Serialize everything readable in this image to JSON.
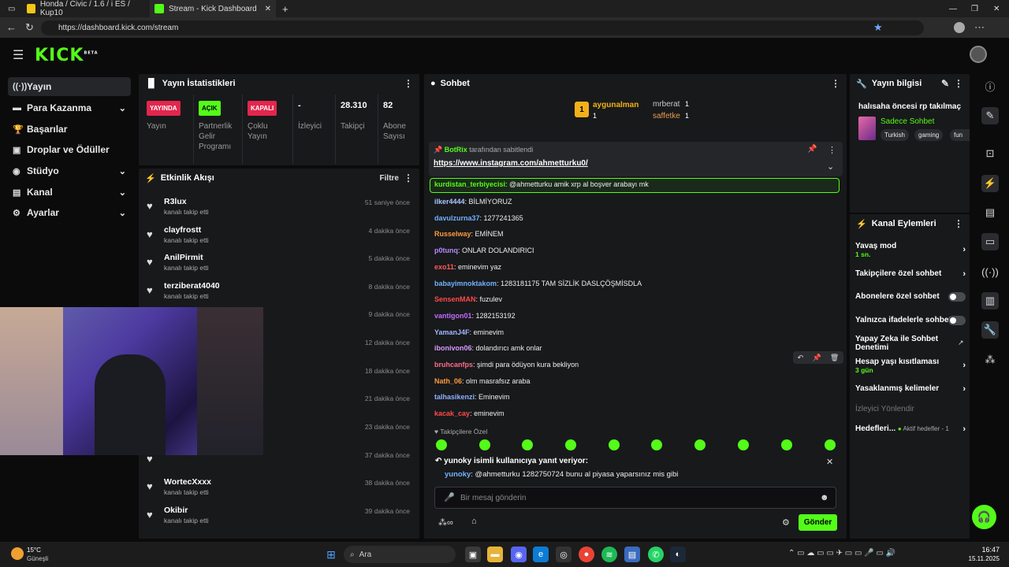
{
  "browser": {
    "tabs": [
      {
        "label": "Honda / Civic / 1.6 / i ES / Kup10"
      },
      {
        "label": "Stream - Kick Dashboard"
      }
    ],
    "url": "https://dashboard.kick.com/stream"
  },
  "brand": {
    "logo": "KICK",
    "beta": "BETA",
    "accent": "#53fc18"
  },
  "sidebar": {
    "items": [
      {
        "label": "Yayın",
        "icon": "broadcast-icon"
      },
      {
        "label": "Para Kazanma",
        "icon": "money-icon"
      },
      {
        "label": "Başarılar",
        "icon": "trophy-icon"
      },
      {
        "label": "Droplar ve Ödüller",
        "icon": "gift-icon"
      },
      {
        "label": "Stüdyo",
        "icon": "studio-icon"
      },
      {
        "label": "Kanal",
        "icon": "channel-icon"
      },
      {
        "label": "Ayarlar",
        "icon": "gear-icon"
      }
    ]
  },
  "stats": {
    "title": "Yayın İstatistikleri",
    "columns": [
      {
        "value": "YAYINDA",
        "label": "Yayın"
      },
      {
        "value": "AÇIK",
        "label": "Partnerlik Gelir Programı"
      },
      {
        "value": "KAPALI",
        "label": "Çoklu Yayın"
      },
      {
        "value": "-",
        "label": "İzleyici"
      },
      {
        "value": "28.310",
        "label": "Takipçi"
      },
      {
        "value": "82",
        "label": "Abone Sayısı"
      }
    ]
  },
  "activity": {
    "title": "Etkinlik Akışı",
    "filter": "Filtre",
    "items": [
      {
        "name": "R3lux",
        "sub": "kanalı takip etti",
        "time": "51 saniye önce"
      },
      {
        "name": "clayfrostt",
        "sub": "kanalı takip etti",
        "time": "4 dakika önce"
      },
      {
        "name": "AnilPirmit",
        "sub": "kanalı takip etti",
        "time": "5 dakika önce"
      },
      {
        "name": "terziberat4040",
        "sub": "kanalı takip etti",
        "time": "8 dakika önce"
      },
      {
        "name": "",
        "sub": "",
        "time": "9 dakika önce"
      },
      {
        "name": "",
        "sub": "",
        "time": "12 dakika önce"
      },
      {
        "name": "",
        "sub": "",
        "time": "18 dakika önce"
      },
      {
        "name": "",
        "sub": "",
        "time": "21 dakika önce"
      },
      {
        "name": "",
        "sub": "",
        "time": "23 dakika önce"
      },
      {
        "name": "",
        "sub": "",
        "time": "37 dakika önce"
      },
      {
        "name": "WortecXxxx",
        "sub": "kanalı takip etti",
        "time": "38 dakika önce"
      },
      {
        "name": "Okibir",
        "sub": "kanalı takip etti",
        "time": "39 dakika önce"
      }
    ]
  },
  "chat": {
    "title": "Sohbet",
    "leaders": [
      {
        "rank": "1",
        "name": "aygunalman",
        "count": "1"
      },
      {
        "name": "mrberat",
        "count": "1"
      },
      {
        "name": "saffetke",
        "count": "1"
      }
    ],
    "pinned": {
      "by": "BotRix",
      "suffix": "tarafından sabitlendi",
      "link": "https://www.instagram.com/ahmetturku0/"
    },
    "highlight": {
      "user": "kurdistan_terbiyecisi",
      "text": ": @ahmetturku amik xrp al boşver arabayı mk"
    },
    "messages": [
      {
        "user": "ilker4444",
        "text": ": BİLMİYORUZ",
        "color": "#a9c7ff"
      },
      {
        "user": "davulzurna37",
        "text": ": 1277241365",
        "color": "#6fb2ff"
      },
      {
        "user": "Russelway",
        "text": ": EMİNEM",
        "color": "#ff9a3c"
      },
      {
        "user": "p0tunq",
        "text": ": ONLAR DOLANDIRICI",
        "color": "#b689ff"
      },
      {
        "user": "exo11",
        "text": ": eminevim yaz",
        "color": "#ff5a5a"
      },
      {
        "user": "babayimnoktakom",
        "text": ": 1283181175 TAM SİZLİK DASLÇÖŞMİSDLA",
        "color": "#6fb2ff"
      },
      {
        "user": "SensenMAN",
        "text": ": fuzulev",
        "color": "#ff4a4a"
      },
      {
        "user": "vantigon01",
        "text": ": 1282153192",
        "color": "#c06bff"
      },
      {
        "user": "YamanJ4F",
        "text": ": eminevim",
        "color": "#9fb7ff"
      },
      {
        "user": "ibonivon06",
        "text": ": dolandırıcı amk onlar",
        "color": "#d59bff"
      },
      {
        "user": "bruhcanfps",
        "text": ": şimdi para ödüyon kura bekliyon",
        "color": "#ff6b8b"
      },
      {
        "user": "Nath_06",
        "text": ": olm masrafsız araba",
        "color": "#ff9a3c"
      },
      {
        "user": "talhasikenzi",
        "text": ": Eminevim",
        "color": "#8fb0ff"
      },
      {
        "user": "kacak_cay",
        "text": ": eminevim",
        "color": "#ff4a4a"
      }
    ],
    "followers_only": "Takipçilere Özel",
    "reply": {
      "header": "yunoky isimli kullanıcıya yanıt veriyor:",
      "user": "yunoky",
      "text": ": @ahmetturku 1282750724 bunu al piyasa yaparsınız mis gibi"
    },
    "input_placeholder": "Bir mesaj gönderin",
    "send": "Gönder"
  },
  "stream_info": {
    "title": "Yayın bilgisi",
    "stream_title": "halısaha öncesi rp takılmaç",
    "category": "Sadece Sohbet",
    "tags": [
      "Turkish",
      "gaming",
      "fun"
    ]
  },
  "channel_actions": {
    "title": "Kanal Eylemleri",
    "slow_mode": "Yavaş mod",
    "slow_mode_value": "1 sn.",
    "followers_chat": "Takipçilere özel sohbet",
    "subs_chat": "Abonelere özel sohbet",
    "emote_chat": "Yalnızca ifadelerle sohbet",
    "ai_mod": "Yapay Zeka ile Sohbet Denetimi",
    "age_limit": "Hesap yaşı kısıtlaması",
    "age_limit_value": "3 gün",
    "banned_words": "Yasaklanmış kelimeler",
    "viewer_redirect": "İzleyici Yönlendir",
    "goals": "Hedefleri...",
    "goals_status": "Aktif hedefler - 1"
  },
  "taskbar": {
    "weather_temp": "15°C",
    "weather_desc": "Güneşli",
    "search": "Ara",
    "time": "16:47",
    "date": "15.11.2025"
  }
}
